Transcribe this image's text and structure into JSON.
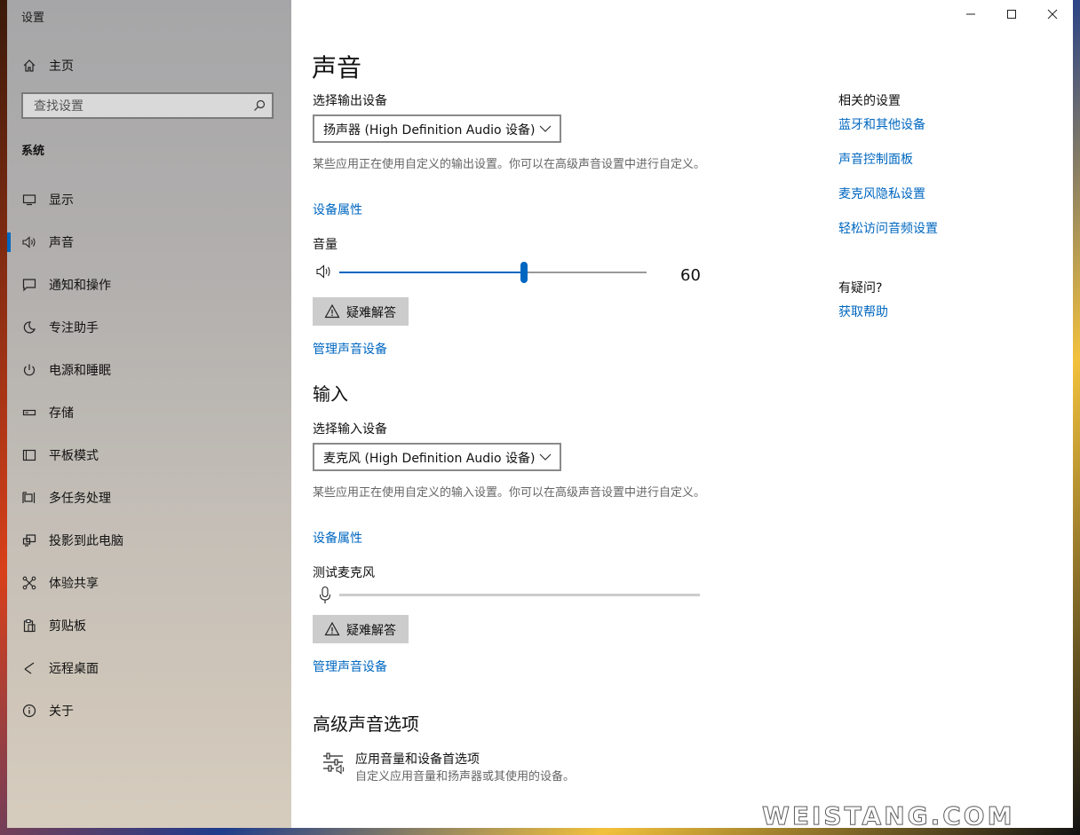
{
  "window": {
    "title": "设置",
    "controls": [
      "minimize-icon",
      "maximize-icon",
      "close-icon"
    ]
  },
  "sidebar": {
    "home": {
      "label": "主页",
      "icon": "home-icon"
    },
    "search": {
      "placeholder": "查找设置",
      "icon": "search-icon"
    },
    "section": "系统",
    "items": [
      {
        "label": "显示",
        "icon": "display-icon",
        "active": false
      },
      {
        "label": "声音",
        "icon": "speaker-icon",
        "active": true
      },
      {
        "label": "通知和操作",
        "icon": "notification-icon",
        "active": false
      },
      {
        "label": "专注助手",
        "icon": "moon-icon",
        "active": false
      },
      {
        "label": "电源和睡眠",
        "icon": "power-icon",
        "active": false
      },
      {
        "label": "存储",
        "icon": "storage-icon",
        "active": false
      },
      {
        "label": "平板模式",
        "icon": "tablet-icon",
        "active": false
      },
      {
        "label": "多任务处理",
        "icon": "multitask-icon",
        "active": false
      },
      {
        "label": "投影到此电脑",
        "icon": "project-icon",
        "active": false
      },
      {
        "label": "体验共享",
        "icon": "share-icon",
        "active": false
      },
      {
        "label": "剪贴板",
        "icon": "clipboard-icon",
        "active": false
      },
      {
        "label": "远程桌面",
        "icon": "remote-desktop-icon",
        "active": false
      },
      {
        "label": "关于",
        "icon": "info-icon",
        "active": false
      }
    ]
  },
  "main": {
    "title": "声音",
    "output": {
      "select_label": "选择输出设备",
      "device": "扬声器 (High Definition Audio 设备)",
      "desc": "某些应用正在使用自定义的输出设置。你可以在高级声音设置中进行自定义。",
      "device_properties": "设备属性",
      "volume_label": "音量",
      "volume_value": "60",
      "volume_level": 0.6,
      "troubleshoot": "疑难解答",
      "manage": "管理声音设备"
    },
    "input": {
      "heading": "输入",
      "select_label": "选择输入设备",
      "device": "麦克风 (High Definition Audio 设备)",
      "desc": "某些应用正在使用自定义的输入设置。你可以在高级声音设置中进行自定义。",
      "device_properties": "设备属性",
      "test_label": "测试麦克风",
      "troubleshoot": "疑难解答",
      "manage": "管理声音设备"
    },
    "advanced": {
      "heading": "高级声音选项",
      "app_volume_title": "应用音量和设备首选项",
      "app_volume_desc": "自定义应用音量和扬声器或其使用的设备。"
    }
  },
  "related": {
    "heading": "相关的设置",
    "links": [
      "蓝牙和其他设备",
      "声音控制面板",
      "麦克风隐私设置",
      "轻松访问音频设置"
    ],
    "help_heading": "有疑问?",
    "help_link": "获取帮助"
  },
  "watermark": "WEISTANG.COM",
  "colors": {
    "accent": "#0067c0",
    "sidebar": "#b3b0ae",
    "button": "#cccccc"
  }
}
